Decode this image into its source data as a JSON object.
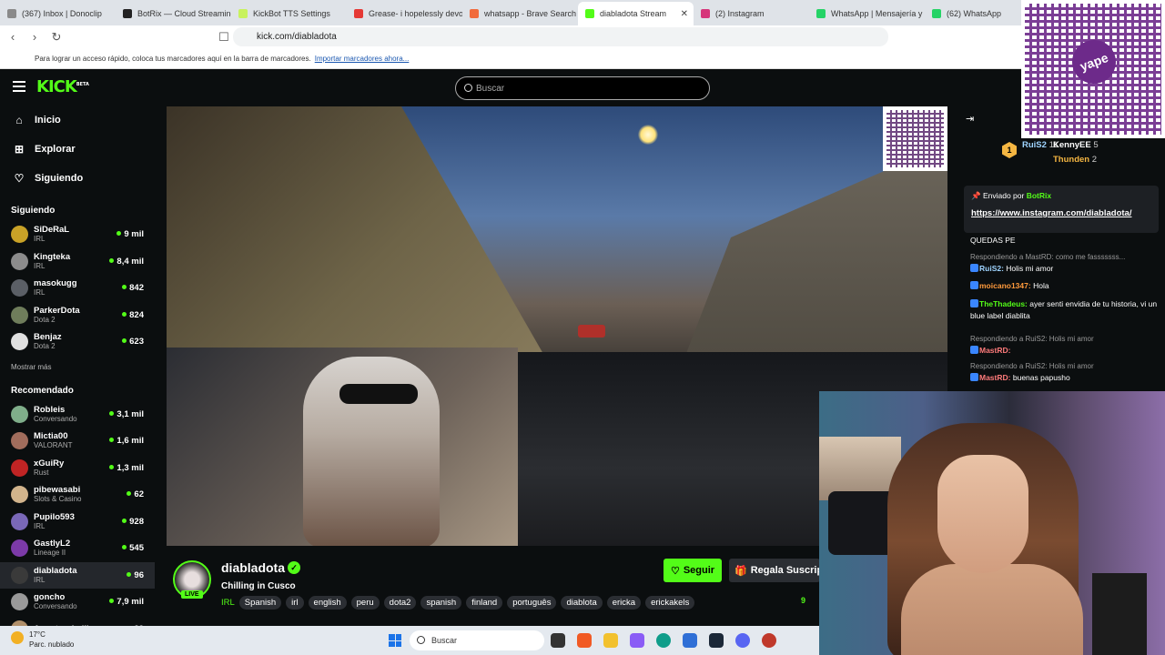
{
  "browser": {
    "tabs": [
      {
        "label": "(367) Inbox | Donoclip",
        "color": "#8a8a8a"
      },
      {
        "label": "BotRix — Cloud Streaming",
        "color": "#222222"
      },
      {
        "label": "KickBot TTS Settings",
        "color": "#c8f25d"
      },
      {
        "label": "Grease- i hopelessly devot",
        "color": "#e53935"
      },
      {
        "label": "whatsapp - Brave Search",
        "color": "#f16b3c"
      },
      {
        "label": "diabladota Stream",
        "color": "#53fc18"
      },
      {
        "label": "(2) Instagram",
        "color": "#d6357a"
      },
      {
        "label": "WhatsApp | Mensajería y",
        "color": "#25d366"
      },
      {
        "label": "(62) WhatsApp",
        "color": "#25d366"
      }
    ],
    "active_tab_close": "✕",
    "url": "kick.com/diabladota",
    "bookmarks_text": "Para lograr un acceso rápido, coloca tus marcadores aquí en la barra de marcadores.",
    "bookmarks_link": "Importar marcadores ahora..."
  },
  "kick": {
    "logo": "KICK",
    "logo_badge": "BETA",
    "search_placeholder": "Buscar"
  },
  "sidebar": {
    "nav": [
      {
        "label": "Inicio",
        "icon": "⌂"
      },
      {
        "label": "Explorar",
        "icon": "⊞"
      },
      {
        "label": "Siguiendo",
        "icon": "♡"
      }
    ],
    "following_title": "Siguiendo",
    "following": [
      {
        "name": "SiDeRaL",
        "cat": "IRL",
        "viewers": "9 mil",
        "color": "#c9a227"
      },
      {
        "name": "Kingteka",
        "cat": "IRL",
        "viewers": "8,4 mil",
        "color": "#8c8c8c"
      },
      {
        "name": "masokugg",
        "cat": "IRL",
        "viewers": "842",
        "color": "#5b5f66"
      },
      {
        "name": "ParkerDota",
        "cat": "Dota 2",
        "viewers": "824",
        "color": "#6f7d5b"
      },
      {
        "name": "Benjaz",
        "cat": "Dota 2",
        "viewers": "623",
        "color": "#e0e0e0"
      }
    ],
    "show_more": "Mostrar más",
    "recommended_title": "Recomendado",
    "recommended": [
      {
        "name": "Robleis",
        "cat": "Conversando",
        "viewers": "3,1 mil",
        "color": "#7fae8a"
      },
      {
        "name": "Mictia00",
        "cat": "VALORANT",
        "viewers": "1,6 mil",
        "color": "#a16d5c"
      },
      {
        "name": "xGuiRy",
        "cat": "Rust",
        "viewers": "1,3 mil",
        "color": "#c02424"
      },
      {
        "name": "pibewasabi",
        "cat": "Slots & Casino",
        "viewers": "62",
        "color": "#d2b48c"
      },
      {
        "name": "Pupilo593",
        "cat": "IRL",
        "viewers": "928",
        "color": "#7a68b8"
      },
      {
        "name": "GastlyL2",
        "cat": "Lineage II",
        "viewers": "545",
        "color": "#7c3aa8"
      },
      {
        "name": "diabladota",
        "cat": "IRL",
        "viewers": "96",
        "color": "#3a3a3a"
      },
      {
        "name": "goncho",
        "cat": "Conversando",
        "viewers": "7,9 mil",
        "color": "#9a9a9a"
      },
      {
        "name": "Agostorchelli",
        "cat": "",
        "viewers": "29",
        "color": "#b08f6a"
      }
    ]
  },
  "stream": {
    "name": "diabladota",
    "verified": "✓",
    "live": "LIVE",
    "title": "Chilling in Cusco",
    "category": "IRL",
    "tags": [
      "Spanish",
      "irl",
      "english",
      "peru",
      "dota2",
      "spanish",
      "finland",
      "português",
      "diablota",
      "ericka",
      "erickakels"
    ],
    "follow_label": "Seguir",
    "sub_label": "Regala Suscrip",
    "viewers_count": "9"
  },
  "chat": {
    "leaderboard": [
      {
        "name": "RuiS2",
        "count": "11",
        "color": "#9fd4ff"
      },
      {
        "name": "KennyEE",
        "count": "5",
        "color": "#ffffff"
      },
      {
        "name": "Thunden",
        "count": "2",
        "color": "#f5b642"
      }
    ],
    "pinned_by_prefix": "Enviado por",
    "pinned_by_user": "BotRix",
    "pinned_url": "https://www.instagram.com/diabladota/",
    "messages": [
      {
        "reply": "",
        "user": "",
        "text": "QUEDAS PE",
        "ucolor": "#ffffff"
      },
      {
        "reply": "Respondiendo a MastRD: como me fasssssss...",
        "user": "RuiS2:",
        "text": "Holis mi amor",
        "ucolor": "#9fd4ff"
      },
      {
        "reply": "",
        "user": "moicano1347:",
        "text": "Hola",
        "ucolor": "#ff9a3c"
      },
      {
        "reply": "",
        "user": "TheThadeus:",
        "text": "ayer senti envidia de tu historia, vi un blue label diablita",
        "ucolor": "#53fc18"
      },
      {
        "reply": "Respondiendo a RuiS2: Holis mi amor",
        "user": "MastRD:",
        "text": "",
        "ucolor": "#ff7b7b"
      },
      {
        "reply": "Respondiendo a RuiS2: Holis mi amor",
        "user": "MastRD:",
        "text": "buenas papusho",
        "ucolor": "#ff7b7b"
      }
    ]
  },
  "yape": {
    "logo": "yape"
  },
  "taskbar": {
    "temp": "17°C",
    "weather": "Parc. nublado",
    "search_placeholder": "Buscar"
  }
}
